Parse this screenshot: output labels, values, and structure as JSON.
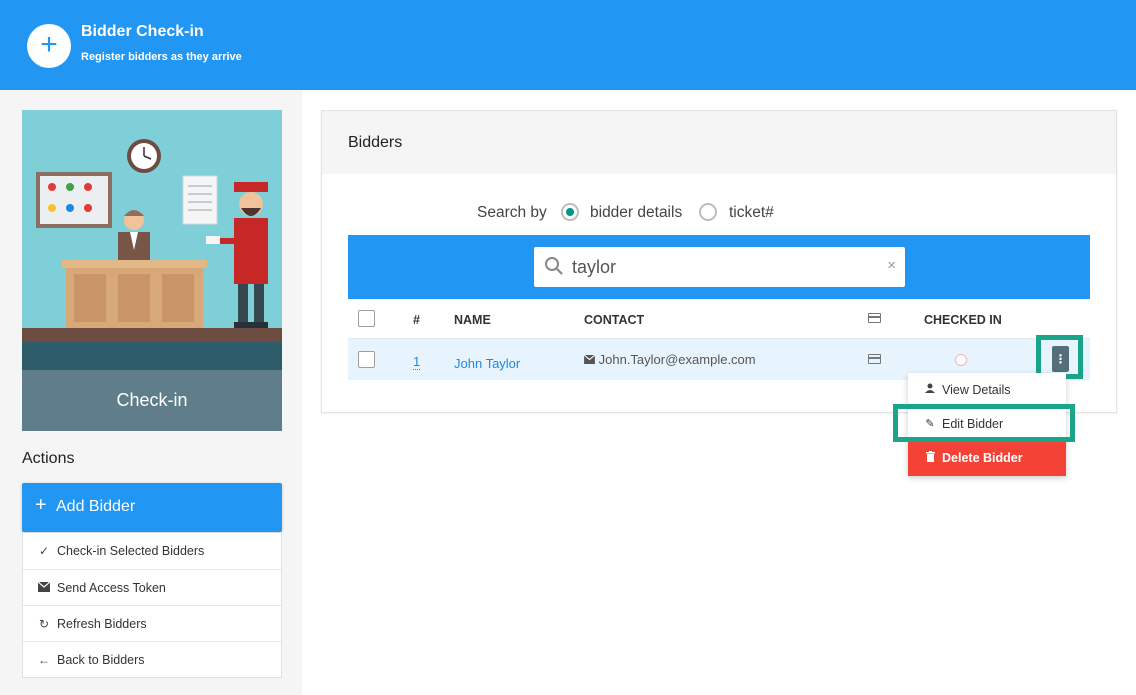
{
  "header": {
    "title": "Bidder Check-in",
    "subtitle": "Register bidders as they arrive"
  },
  "sidebar": {
    "image_caption": "Check-in",
    "actions_heading": "Actions",
    "add_button_label": "Add Bidder",
    "actions": [
      {
        "label": "Check-in Selected Bidders",
        "icon": "check-icon"
      },
      {
        "label": "Send Access Token",
        "icon": "envelope-icon"
      },
      {
        "label": "Refresh Bidders",
        "icon": "refresh-icon"
      },
      {
        "label": "Back to Bidders",
        "icon": "arrow-left-icon"
      }
    ]
  },
  "panel": {
    "title": "Bidders",
    "search_by_label": "Search by",
    "search_options": [
      {
        "label": "bidder details",
        "selected": true
      },
      {
        "label": "ticket#",
        "selected": false
      }
    ],
    "search_value": "taylor",
    "clear_symbol": "×"
  },
  "table": {
    "headers": {
      "num": "#",
      "name": "NAME",
      "contact": "CONTACT",
      "checked_in": "CHECKED IN"
    },
    "rows": [
      {
        "num": "1",
        "name": "John Taylor",
        "contact": "John.Taylor@example.com",
        "checked_in": false
      }
    ]
  },
  "row_menu": {
    "items": [
      {
        "label": "View Details",
        "icon": "person-icon"
      },
      {
        "label": "Edit Bidder",
        "icon": "pencil-icon"
      },
      {
        "label": "Delete Bidder",
        "icon": "trash-icon"
      }
    ]
  },
  "colors": {
    "primary": "#2196f3",
    "radio_selected": "#009688",
    "highlight": "#1aa58b",
    "danger": "#f44336",
    "link": "#1e88e5"
  }
}
